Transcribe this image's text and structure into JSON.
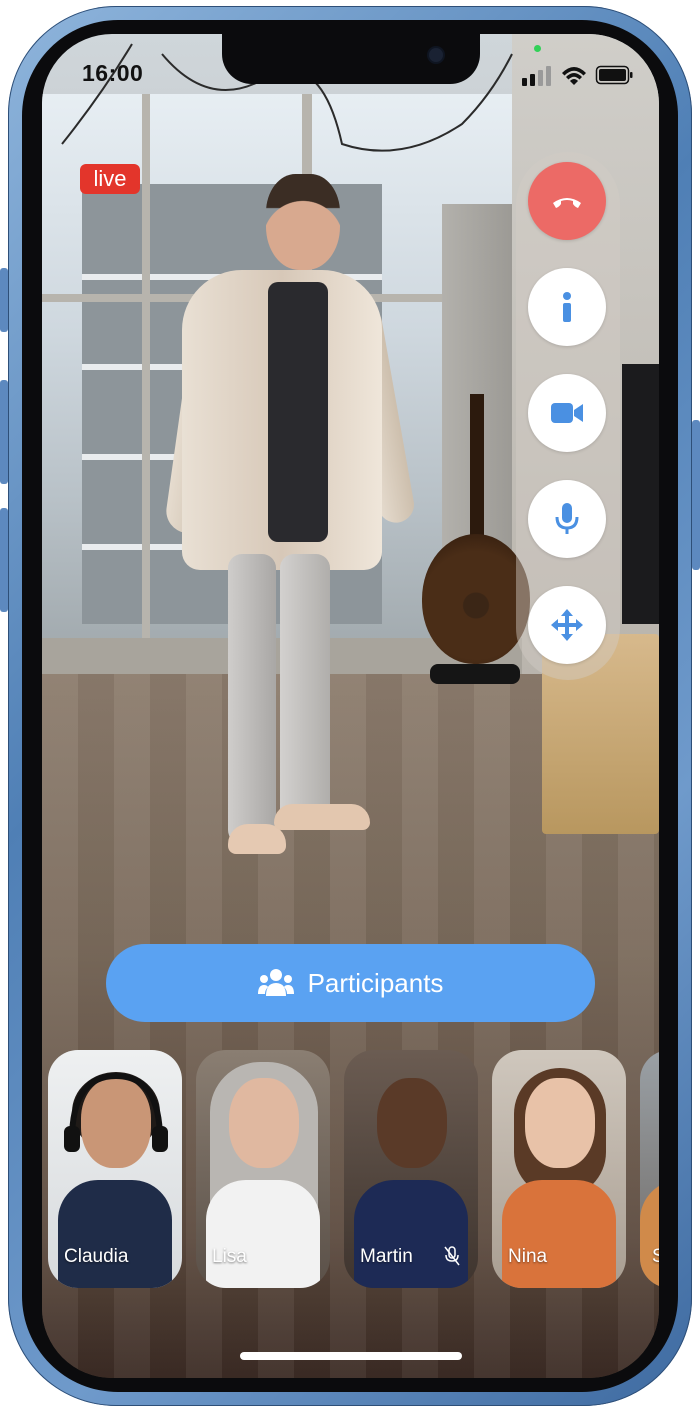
{
  "status_bar": {
    "time": "16:00"
  },
  "call": {
    "live_label": "live"
  },
  "controls": {
    "end_call": "end-call",
    "info": "info",
    "camera": "camera",
    "microphone": "microphone",
    "move": "move"
  },
  "participants_button": {
    "label": "Participants"
  },
  "participants": [
    {
      "name": "Claudia",
      "muted": false
    },
    {
      "name": "Lisa",
      "muted": false
    },
    {
      "name": "Martin",
      "muted": true
    },
    {
      "name": "Nina",
      "muted": false
    },
    {
      "name": "S",
      "muted": false
    }
  ],
  "colors": {
    "frame": "#5a88be",
    "live_badge": "#e3352b",
    "end_call": "#ec6a66",
    "accent": "#5aa2f2",
    "icon_blue": "#4a90e2"
  }
}
